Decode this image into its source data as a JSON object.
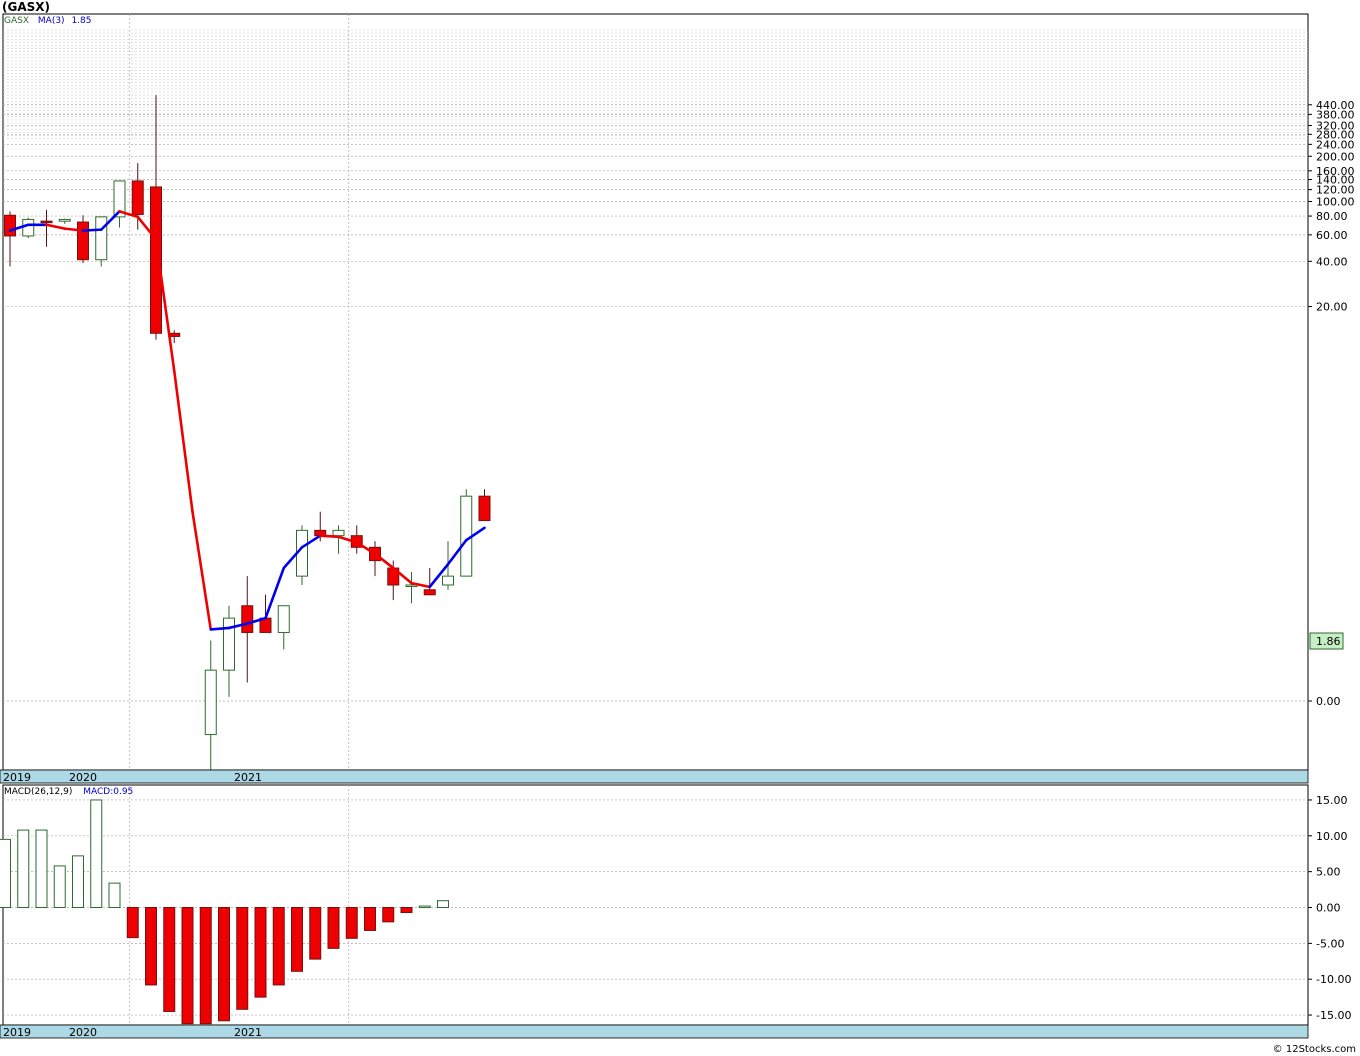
{
  "title": "(GASX)",
  "copyright": "© 12Stocks.com",
  "colors": {
    "up_candle_border": "#2e6b2e",
    "down_candle_fill": "#ee0000",
    "ma_up": "#0000ee",
    "ma_down": "#ee0000",
    "timeline_band": "#add8e6",
    "grid": "#aaaaaa",
    "last_price_bg": "#c6efc6"
  },
  "price_panel": {
    "legend_symbol": "GASX",
    "legend_ma": "MA(3)",
    "legend_ma_value": "1.85",
    "last_price_label": "1.86",
    "y_tick_labels": [
      "440.00",
      "380.00",
      "320.00",
      "280.00",
      "240.00",
      "200.00",
      "160.00",
      "140.00",
      "120.00",
      "100.00",
      "80.00",
      "60.00",
      "40.00",
      "20.00",
      "0.00"
    ],
    "year_labels": [
      "2019",
      "2020",
      "2021"
    ]
  },
  "macd_panel": {
    "legend": "MACD(26,12,9)",
    "legend_value": "MACD:0.95",
    "y_tick_labels": [
      "15.00",
      "10.00",
      "5.00",
      "0.00",
      "-5.00",
      "-10.00",
      "-15.00"
    ],
    "year_labels": [
      "2019",
      "2020",
      "2021"
    ]
  },
  "chart_data": [
    {
      "type": "candlestick",
      "title": "(GASX)",
      "scale": "log",
      "x": [
        "2019-06",
        "2019-07",
        "2019-08",
        "2019-09",
        "2019-10",
        "2019-11",
        "2019-12",
        "2020-01",
        "2020-02",
        "2020-03",
        "2020-04",
        "2020-05",
        "2020-06",
        "2020-07",
        "2020-08",
        "2020-09",
        "2020-10",
        "2020-11",
        "2020-12",
        "2021-01",
        "2021-02",
        "2021-03",
        "2021-04",
        "2021-05",
        "2021-06",
        "2021-07",
        "2021-08"
      ],
      "open": [
        81,
        59,
        74,
        74,
        73,
        41,
        79,
        137,
        125,
        15,
        null,
        0.2,
        0.4,
        0.8,
        0.7,
        0.6,
        1.1,
        1.8,
        1.7,
        1.7,
        1.5,
        1.2,
        1.0,
        0.95,
        1.0,
        1.1,
        2.6
      ],
      "high": [
        86,
        78,
        88,
        77,
        81,
        79,
        94,
        180,
        510,
        15.5,
        null,
        0.55,
        0.8,
        1.1,
        0.9,
        0.8,
        1.9,
        2.2,
        1.9,
        1.9,
        1.6,
        1.3,
        1.15,
        1.2,
        1.6,
        2.8,
        2.8
      ],
      "low": [
        37,
        57,
        50,
        71,
        39,
        37,
        67,
        65,
        14,
        13.5,
        null,
        0.13,
        0.3,
        0.35,
        0.6,
        0.5,
        1.0,
        1.6,
        1.4,
        1.4,
        1.1,
        0.85,
        0.82,
        0.9,
        0.95,
        1.3,
        2.0
      ],
      "close": [
        59,
        76,
        73,
        76,
        41,
        79,
        137,
        82,
        15,
        14.5,
        null,
        0.4,
        0.7,
        0.6,
        0.6,
        0.8,
        1.8,
        1.7,
        1.8,
        1.5,
        1.3,
        1.0,
        1.0,
        0.9,
        1.1,
        2.6,
        2.0
      ],
      "ma_label": "MA(3)",
      "ma_x": [
        "2019-06",
        "2019-07",
        "2019-08",
        "2019-09",
        "2019-10",
        "2019-11",
        "2019-12",
        "2020-01",
        "2020-02",
        "2020-03",
        "2020-04",
        "2020-05",
        "2020-06",
        "2020-07",
        "2020-08",
        "2020-09",
        "2020-10",
        "2020-11",
        "2020-12",
        "2021-01",
        "2021-02",
        "2021-03",
        "2021-04",
        "2021-05",
        "2021-06",
        "2021-07",
        "2021-08"
      ],
      "ma": [
        64,
        70,
        70,
        66,
        64,
        65,
        86,
        79,
        56,
        10,
        2.2,
        0.62,
        0.63,
        0.66,
        0.7,
        1.2,
        1.5,
        1.7,
        1.68,
        1.58,
        1.4,
        1.2,
        1.02,
        0.98,
        1.25,
        1.62,
        1.85
      ],
      "y_ticks": [
        440,
        380,
        320,
        280,
        240,
        200,
        160,
        140,
        120,
        100,
        80,
        60,
        40,
        20
      ],
      "last_price": 1.86
    },
    {
      "type": "bar",
      "title": "MACD(26,12,9)",
      "x": [
        "2019-06",
        "2019-07",
        "2019-08",
        "2019-09",
        "2019-10",
        "2019-11",
        "2019-12",
        "2020-01",
        "2020-02",
        "2020-03",
        "2020-04",
        "2020-05",
        "2020-06",
        "2020-07",
        "2020-08",
        "2020-09",
        "2020-10",
        "2020-11",
        "2020-12",
        "2021-01",
        "2021-02",
        "2021-03",
        "2021-04",
        "2021-05",
        "2021-06",
        "2021-07",
        "2021-08"
      ],
      "values": [
        9.5,
        10.8,
        10.8,
        5.8,
        7.2,
        15.0,
        3.4,
        -4.2,
        -10.8,
        -14.5,
        -16.2,
        -16.2,
        -15.8,
        -14.2,
        -12.5,
        -10.8,
        -8.9,
        -7.2,
        -5.7,
        -4.3,
        -3.2,
        -2.0,
        -0.7,
        0.2,
        0.95
      ],
      "ylim": [
        -16.5,
        16
      ],
      "y_ticks": [
        15,
        10,
        5,
        0,
        -5,
        -10,
        -15
      ]
    }
  ]
}
